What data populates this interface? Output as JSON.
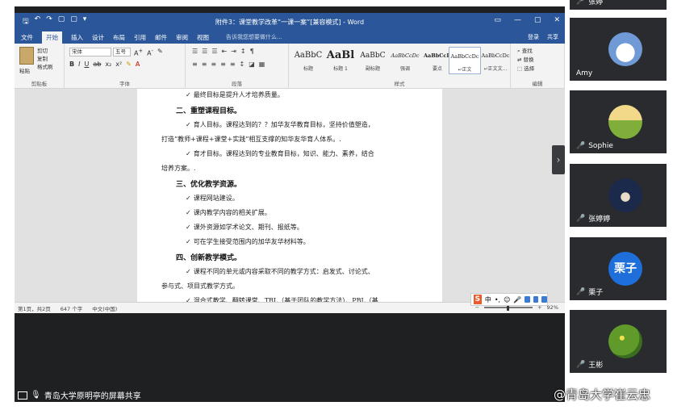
{
  "word": {
    "title": "附件3：课堂教学改革“一课一案”[兼容模式] - Word",
    "qat": [
      "🖫",
      "↶",
      "↷",
      "▢",
      "▢",
      "▾"
    ],
    "window_buttons": [
      "▭",
      "—",
      "▢",
      "✕"
    ],
    "tabs": [
      "文件",
      "开始",
      "插入",
      "设计",
      "布局",
      "引用",
      "邮件",
      "审阅",
      "视图"
    ],
    "tell_me": "告诉我您想要做什么...",
    "login": "登录",
    "share": "共享",
    "clipboard": {
      "paste": "粘贴",
      "cut": "剪切",
      "copy": "复制",
      "format_painter": "格式刷",
      "label": "剪贴板"
    },
    "font_group": {
      "font": "宋体",
      "size": "五号",
      "label": "字体"
    },
    "para_label": "段落",
    "styles_label": "样式",
    "styles": [
      {
        "sample": "AaBbC",
        "name": "标题"
      },
      {
        "sample": "AaBl",
        "name": "标题 1"
      },
      {
        "sample": "AaBbC",
        "name": "副标题"
      },
      {
        "sample": "AaBbCcDc",
        "name": "强调"
      },
      {
        "sample": "AaBbCcD",
        "name": "要点"
      },
      {
        "sample": "AaBbCcDc",
        "name": "↵正文"
      },
      {
        "sample": "AaBbCcDc",
        "name": "↵正文文..."
      }
    ],
    "editing": {
      "find": "查找",
      "replace": "替换",
      "select": "选择",
      "label": "编辑"
    },
    "doc_lines": [
      {
        "type": "item",
        "text": "最终目标是提升人才培养质量。"
      },
      {
        "type": "heading",
        "text": "二、重塑课程目标。"
      },
      {
        "type": "item",
        "text": "育人目标。课程达到的？？加华友华教育目标，坚持价值塑造，"
      },
      {
        "type": "cont",
        "text": "打造“教师+课程+课堂+实践”相互支撑的知华友华育人体系。."
      },
      {
        "type": "item",
        "text": "育才目标。课程达到的专业教育目标，知识、能力、素养，结合"
      },
      {
        "type": "cont",
        "text": "培养方案。."
      },
      {
        "type": "heading",
        "text": "三、优化教学资源。"
      },
      {
        "type": "item",
        "text": "课程网站建设。"
      },
      {
        "type": "item",
        "text": "课内教学内容的相关扩展。"
      },
      {
        "type": "item",
        "text": "课外资源如学术论文、期刊、报纸等。"
      },
      {
        "type": "item",
        "text": "可在学生接受范围内的加华友华材料等。"
      },
      {
        "type": "heading",
        "text": "四、创新教学模式。"
      },
      {
        "type": "item",
        "text": "课程不同的单元或内容采取不同的教学方式：启发式、讨论式、"
      },
      {
        "type": "cont",
        "text": "参与式、项目式教学方式。"
      },
      {
        "type": "item",
        "text": "混合式教学、翻转课堂、TBL（基于团队的教学方法）、PBL（基"
      }
    ],
    "status": {
      "page": "第1页，共2页",
      "words": "647 个字",
      "lang": "中文(中国)",
      "zoom": "92%"
    },
    "ime": [
      "中",
      "•,",
      "☺",
      "🎤"
    ]
  },
  "share_caption": "青岛大学原明亭的屏幕共享",
  "participants": [
    {
      "name": "张婷",
      "muted": true,
      "avatar": "photo"
    },
    {
      "name": "Amy",
      "muted": false,
      "avatar": "cloud-sky"
    },
    {
      "name": "Sophie",
      "muted": true,
      "avatar": "field-sunset"
    },
    {
      "name": "张婷婷",
      "muted": true,
      "avatar": "castle-night"
    },
    {
      "name": "栗子",
      "muted": true,
      "avatar": "text",
      "avatar_text": "栗子"
    },
    {
      "name": "王彬",
      "muted": true,
      "avatar": "flowers"
    }
  ],
  "watermark": "@青岛大学崔云忠",
  "colors": {
    "word_blue": "#2b579a",
    "mic_red": "#e23b3b",
    "lizi_blue": "#1e6fd9"
  }
}
